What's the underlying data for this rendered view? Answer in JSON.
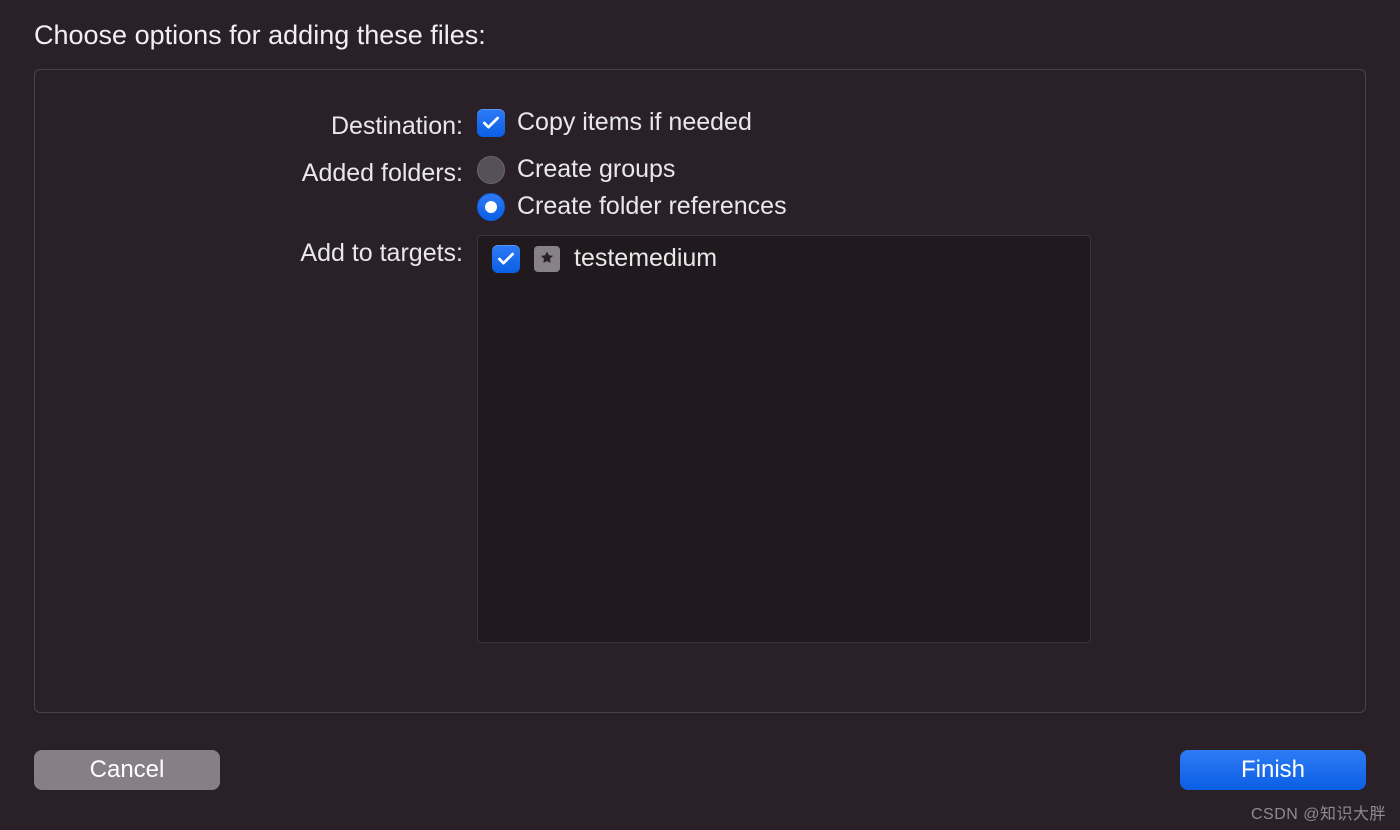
{
  "title": "Choose options for adding these files:",
  "rows": {
    "destination": {
      "label": "Destination:",
      "option_label": "Copy items if needed",
      "checked": true
    },
    "added_folders": {
      "label": "Added folders:",
      "option_groups": "Create groups",
      "option_references": "Create folder references",
      "selected": "references"
    },
    "add_to_targets": {
      "label": "Add to targets:",
      "items": [
        {
          "checked": true,
          "name": "testemedium"
        }
      ]
    }
  },
  "buttons": {
    "cancel": "Cancel",
    "finish": "Finish"
  },
  "watermark": "CSDN @知识大胖"
}
